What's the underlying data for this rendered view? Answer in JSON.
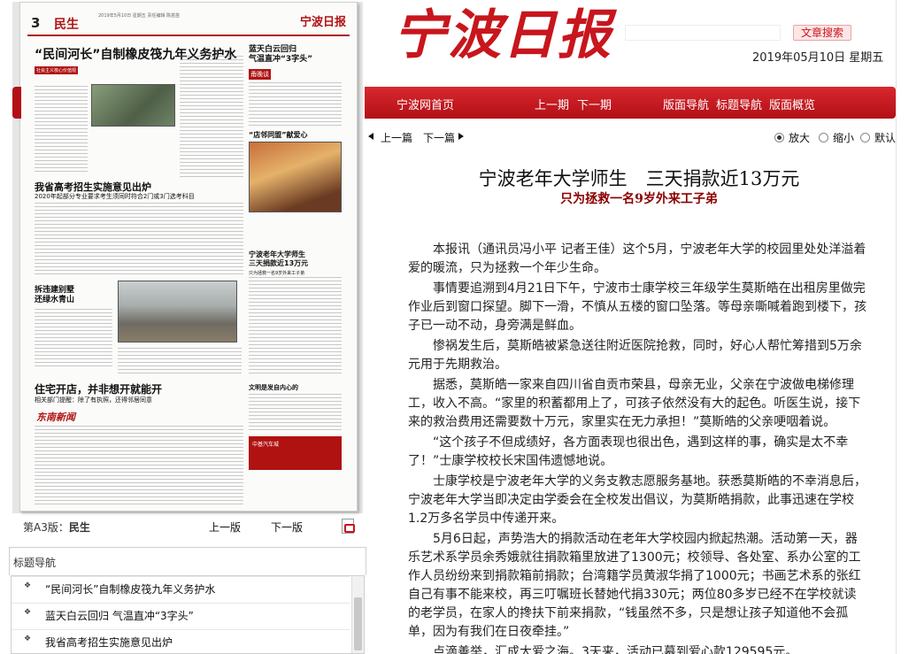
{
  "masthead": "宁波日报",
  "search": {
    "placeholder": "",
    "button": "文章搜索"
  },
  "date": "2019年05月10日  星期五",
  "nav": [
    "宁波网首页",
    "上一期",
    "下一期",
    "版面导航",
    "标题导航",
    "版面概览"
  ],
  "page_preview": {
    "page_number": "3",
    "section": "民生",
    "meta": "2019年5月10日 星期五\n责任编辑 陈苗苗",
    "mast": "宁波日报",
    "headline": "“民间河长”自制橡皮筏九年义务护水",
    "right_top": "蓝天白云回归\n气温直冲“3字头”",
    "h_exam": "我省高考招生实施意见出炉",
    "h_exam_sub": "2020年起部分专业要求考生须同时符合2门或3门选考科目",
    "h_demolish": "拆违建别墅\n还绿水青山",
    "h_housing": "住宅开店，并非想开就能开",
    "h_housing_sub": "相关部门提醒：除了有执照，还得邻居同意",
    "h_donation": "宁波老年大学师生\n三天捐款近13万元",
    "h_donation_sub": "只为拯救一名9岁外来工子弟",
    "h_store": "“店邻同盟”献爱心",
    "h_civil": "文明是发自内心的",
    "logo_wan": "甬晚谈",
    "logo_dongnan": "东南新闻",
    "ad_text": "中基汽车城"
  },
  "page_nav": {
    "label_prefix": "第A3版：",
    "label_name": "民生",
    "prev": "上一版",
    "next": "下一版"
  },
  "title_nav": {
    "heading": "标题导航",
    "items": [
      "“民间河长”自制橡皮筏九年义务护水",
      "蓝天白云回归 气温直冲“3字头”",
      "我省高考招生实施意见出炉"
    ]
  },
  "article_tools": {
    "prev": "上一篇",
    "next": "下一篇",
    "zoom_in": "放大",
    "zoom_out": "缩小",
    "default": "默认",
    "selected": "放大"
  },
  "article": {
    "title": "宁波老年大学师生　三天捐款近13万元",
    "subtitle": "只为拯救一名9岁外来工子弟",
    "paragraphs": [
      "本报讯（通讯员冯小平 记者王佳）这个5月，宁波老年大学的校园里处处洋溢着爱的暖流，只为拯救一个年少生命。",
      "事情要追溯到4月21日下午，宁波市士康学校三年级学生莫斯皓在出租房里做完作业后到窗口探望。脚下一滑，不慎从五楼的窗口坠落。等母亲嘶喊着跑到楼下，孩子已一动不动，身旁满是鲜血。",
      "惨祸发生后，莫斯皓被紧急送往附近医院抢救，同时，好心人帮忙筹措到5万余元用于先期救治。",
      "据悉，莫斯皓一家来自四川省自贡市荣县，母亲无业，父亲在宁波做电梯修理工，收入不高。“家里的积蓄都用上了，可孩子依然没有大的起色。听医生说，接下来的救治费用还需要数十万元，家里实在无力承担！”莫斯皓的父亲哽咽着说。",
      "“这个孩子不但成绩好，各方面表现也很出色，遇到这样的事，确实是太不幸了！”士康学校校长宋国伟遗憾地说。",
      "士康学校是宁波老年大学的义务支教志愿服务基地。获悉莫斯皓的不幸消息后，宁波老年大学当即决定由学委会在全校发出倡议，为莫斯皓捐款，此事迅速在学校1.2万多名学员中传递开来。",
      "5月6日起，声势浩大的捐款活动在老年大学校园内掀起热潮。活动第一天，器乐艺术系学员余秀娥就往捐款箱里放进了1300元；校领导、各处室、系办公室的工作人员纷纷来到捐款箱前捐款；台湾籍学员黄淑华捐了1000元；书画艺术系的张红自己有事不能来校，再三叮嘱班长替她代捐330元；两位80多岁已经不在学校就读的老学员，在家人的搀扶下前来捐款，“钱虽然不多，只是想让孩子知道他不会孤单，因为有我们在日夜牵挂。”",
      "点滴善举，汇成大爱之海。3天来，活动已募到爱心款129595元。"
    ]
  },
  "colors": {
    "brand_red": "#c8161d",
    "subtitle": "#8b0000"
  }
}
